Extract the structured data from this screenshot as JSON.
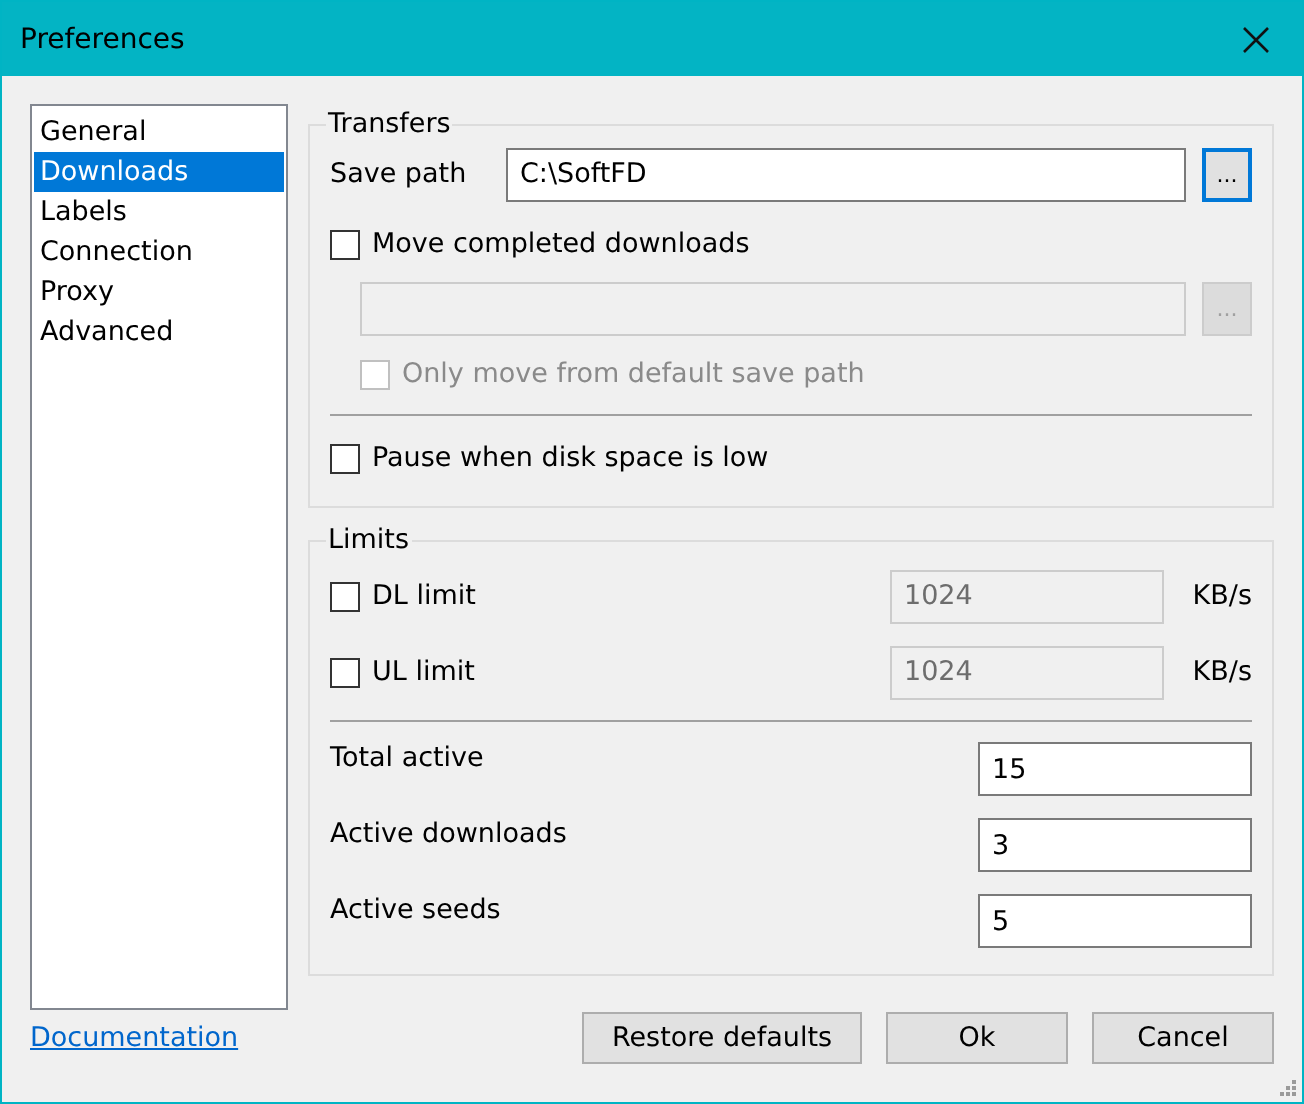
{
  "window": {
    "title": "Preferences"
  },
  "sidebar": {
    "items": [
      {
        "label": "General",
        "selected": false
      },
      {
        "label": "Downloads",
        "selected": true
      },
      {
        "label": "Labels",
        "selected": false
      },
      {
        "label": "Connection",
        "selected": false
      },
      {
        "label": "Proxy",
        "selected": false
      },
      {
        "label": "Advanced",
        "selected": false
      }
    ]
  },
  "transfers": {
    "title": "Transfers",
    "save_path": {
      "label": "Save path",
      "value": "C:\\SoftFD",
      "browse_label": "...",
      "browse_focused": true
    },
    "move_completed": {
      "label": "Move completed downloads",
      "checked": false
    },
    "move_path": {
      "disabled": true,
      "browse_label": "..."
    },
    "only_default": {
      "label": "Only move from default save path",
      "checked": false,
      "disabled": true
    },
    "pause_low_disk": {
      "label": "Pause when disk space is low",
      "checked": false
    }
  },
  "limits": {
    "title": "Limits",
    "rate_limits": [
      {
        "label": "DL limit",
        "checked": false,
        "value": "1024",
        "unit": "KB/s",
        "disabled": true
      },
      {
        "label": "UL limit",
        "checked": false,
        "value": "1024",
        "unit": "KB/s",
        "disabled": true
      }
    ],
    "counts": [
      {
        "label": "Total active",
        "value": "15"
      },
      {
        "label": "Active downloads",
        "value": "3"
      },
      {
        "label": "Active seeds",
        "value": "5"
      }
    ]
  },
  "footer": {
    "link": "Documentation",
    "buttons": [
      "Restore defaults",
      "Ok",
      "Cancel"
    ]
  }
}
